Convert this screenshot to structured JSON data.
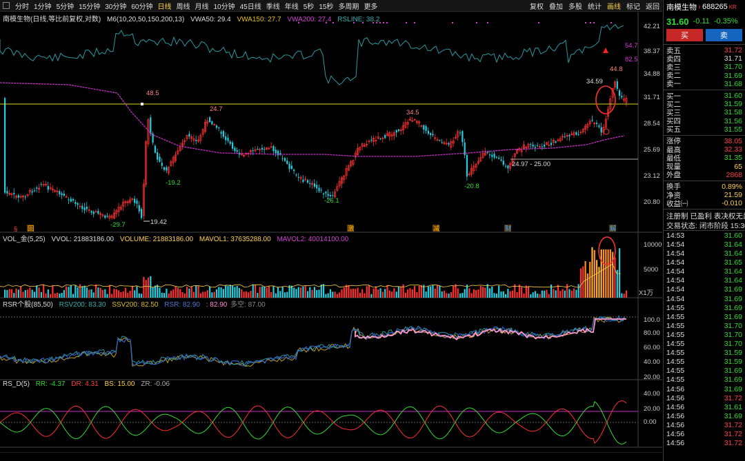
{
  "toolbar": {
    "tabs": [
      "分时",
      "1分钟",
      "5分钟",
      "15分钟",
      "30分钟",
      "60分钟",
      "日线",
      "周线",
      "月线",
      "10分钟",
      "45日线",
      "季线",
      "年线",
      "5秒",
      "15秒",
      "多周期",
      "更多"
    ],
    "active": "日线",
    "right": [
      "复权",
      "叠加",
      "多股",
      "统计",
      "画线",
      "标记",
      "返回"
    ],
    "right_active": "画线"
  },
  "main_legend": {
    "name": "南模生物(日线,等比前复权,对数)",
    "m6": "M6(10,20,50,150,200,13)",
    "vwa50": "VWA50: 29.4",
    "vwa150": "VWA150: 27.7",
    "vwa200": "VWA200: 27.4",
    "rsline": "RSLINE: 38.2"
  },
  "main_axis": [
    "42.21",
    "38.37",
    "34.88",
    "31.71",
    "28.54",
    "25.69",
    "23.12",
    "20.80"
  ],
  "annotations": {
    "a1": "48.5",
    "a2": "24.7",
    "a3": "-19.2",
    "a4": "34.5",
    "a5": "-26.1",
    "a6": "-29.7",
    "a7": "19.42",
    "a8": "-20.8",
    "a9": "24.97 - 25.00",
    "a10": "34.59",
    "a11": "44.8",
    "a12": "54.7",
    "a13": "82.5"
  },
  "event_marks": [
    "§",
    "回",
    "激",
    "减",
    "财",
    "解"
  ],
  "vol_legend": {
    "name": "VOL_金(5,25)",
    "vvol": "VVOL: 21883186.00",
    "volume": "VOLUME: 21883186.00",
    "mavol1": "MAVOL1: 37635288.00",
    "mavol2": "MAVOL2: 40014100.00"
  },
  "vol_axis": [
    "10000",
    "5000",
    "X1万"
  ],
  "rsr_legend": {
    "name": "RSR个股(85,50)",
    "rsv200": "RSV200: 83.30",
    "ssv200": "SSV200: 82.50",
    "rsr": "RSR: 82.90",
    "val": ": 82.90",
    "dk": "多空: 87.00"
  },
  "rsr_axis": [
    "100.0",
    "80.00",
    "60.00",
    "40.00",
    "20.00"
  ],
  "rsd_legend": {
    "name": "RS_D(5)",
    "rr": "RR: -4.37",
    "dr": "DR: 4.31",
    "bs": "BS: 15.00",
    "zr": "ZR: -0.06"
  },
  "rsd_axis": [
    "40.00",
    "20.00",
    "0.00"
  ],
  "x_axis": [
    "2024年",
    "8",
    "9",
    "10",
    "11",
    "12",
    "1",
    "2",
    "3",
    "4",
    "5",
    "6",
    "7"
  ],
  "x_axis_end": "日线",
  "quote": {
    "name": "南模生物",
    "code": "688265",
    "badge": "i",
    "kr": "KR",
    "price": "31.60",
    "change": "-0.11",
    "pct": "-0.35%",
    "buy_btn": "买",
    "sell_btn": "卖",
    "asks": [
      {
        "l": "卖五",
        "v": "31.72",
        "c": "#ff4040"
      },
      {
        "l": "卖四",
        "v": "31.71",
        "c": "#dddddd"
      },
      {
        "l": "卖三",
        "v": "31.70",
        "c": "#33dd33"
      },
      {
        "l": "卖二",
        "v": "31.69",
        "c": "#33dd33"
      },
      {
        "l": "卖一",
        "v": "31.68",
        "c": "#33dd33"
      }
    ],
    "bids": [
      {
        "l": "买一",
        "v": "31.60",
        "c": "#33dd33"
      },
      {
        "l": "买二",
        "v": "31.59",
        "c": "#33dd33"
      },
      {
        "l": "买三",
        "v": "31.58",
        "c": "#33dd33"
      },
      {
        "l": "买四",
        "v": "31.56",
        "c": "#33dd33"
      },
      {
        "l": "买五",
        "v": "31.55",
        "c": "#33dd33"
      }
    ],
    "stats1": [
      {
        "l": "涨停",
        "v": "38.05",
        "c": "#ff4040"
      },
      {
        "l": "最高",
        "v": "32.33",
        "c": "#ff4040"
      },
      {
        "l": "最低",
        "v": "31.35",
        "c": "#33dd33"
      },
      {
        "l": "现量",
        "v": "65",
        "c": "#ffd24a"
      },
      {
        "l": "外盘",
        "v": "2868",
        "c": "#ff4040"
      }
    ],
    "stats2": [
      {
        "l": "换手",
        "v": "0.89%",
        "c": "#ffd24a"
      },
      {
        "l": "净资",
        "v": "21.59",
        "c": "#ffd24a"
      },
      {
        "l": "收益㈠",
        "v": "-0.010",
        "c": "#ffd24a"
      }
    ],
    "tags": "注册制 已盈利 表决权无差",
    "status": "交易状态: 闭市阶段 15:30",
    "ticks": [
      {
        "t": "14:53",
        "p": "31.60",
        "c": "#33dd33"
      },
      {
        "t": "14:54",
        "p": "31.64",
        "c": "#33dd33"
      },
      {
        "t": "14:54",
        "p": "31.64",
        "c": "#33dd33"
      },
      {
        "t": "14:54",
        "p": "31.65",
        "c": "#33dd33"
      },
      {
        "t": "14:54",
        "p": "31.64",
        "c": "#33dd33"
      },
      {
        "t": "14:54",
        "p": "31.64",
        "c": "#33dd33"
      },
      {
        "t": "14:54",
        "p": "31.69",
        "c": "#33dd33"
      },
      {
        "t": "14:54",
        "p": "31.69",
        "c": "#33dd33"
      },
      {
        "t": "14:55",
        "p": "31.69",
        "c": "#33dd33"
      },
      {
        "t": "14:55",
        "p": "31.69",
        "c": "#33dd33"
      },
      {
        "t": "14:55",
        "p": "31.70",
        "c": "#33dd33"
      },
      {
        "t": "14:55",
        "p": "31.70",
        "c": "#33dd33"
      },
      {
        "t": "14:55",
        "p": "31.70",
        "c": "#33dd33"
      },
      {
        "t": "14:55",
        "p": "31.59",
        "c": "#33dd33"
      },
      {
        "t": "14:55",
        "p": "31.59",
        "c": "#33dd33"
      },
      {
        "t": "14:55",
        "p": "31.69",
        "c": "#33dd33"
      },
      {
        "t": "14:55",
        "p": "31.69",
        "c": "#33dd33"
      },
      {
        "t": "14:56",
        "p": "31.69",
        "c": "#33dd33"
      },
      {
        "t": "14:56",
        "p": "31.72",
        "c": "#ff4040"
      },
      {
        "t": "14:56",
        "p": "31.61",
        "c": "#33dd33"
      },
      {
        "t": "14:56",
        "p": "31.69",
        "c": "#33dd33"
      },
      {
        "t": "14:56",
        "p": "31.72",
        "c": "#ff4040"
      },
      {
        "t": "14:56",
        "p": "31.72",
        "c": "#ff4040"
      },
      {
        "t": "14:56",
        "p": "31.72",
        "c": "#ff4040"
      }
    ]
  }
}
